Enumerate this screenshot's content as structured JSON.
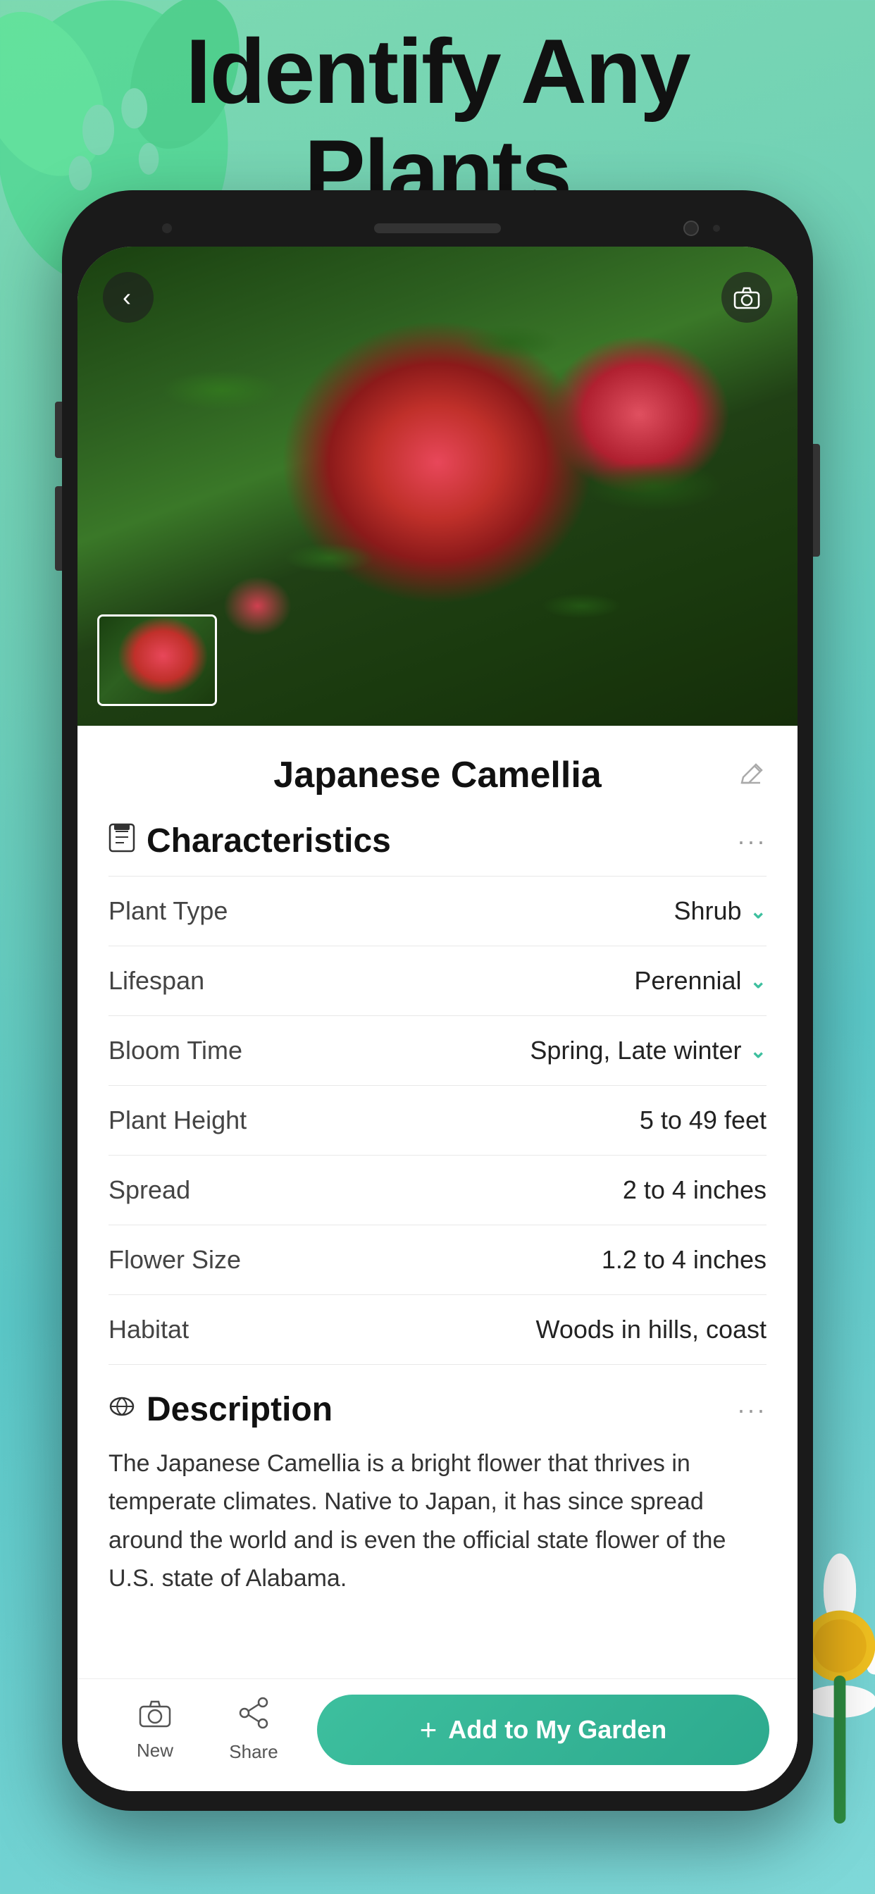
{
  "hero": {
    "title_line1": "Identify Any",
    "title_line2": "Plants"
  },
  "phone": {
    "plant_name": "Japanese Camellia",
    "sections": {
      "characteristics": {
        "title": "Characteristics",
        "icon": "📋",
        "rows": [
          {
            "label": "Plant Type",
            "value": "Shrub",
            "has_chevron": true
          },
          {
            "label": "Lifespan",
            "value": "Perennial",
            "has_chevron": true
          },
          {
            "label": "Bloom Time",
            "value": "Spring, Late winter",
            "has_chevron": true
          },
          {
            "label": "Plant Height",
            "value": "5 to 49 feet",
            "has_chevron": false
          },
          {
            "label": "Spread",
            "value": "2 to 4 inches",
            "has_chevron": false
          },
          {
            "label": "Flower Size",
            "value": "1.2 to 4 inches",
            "has_chevron": false
          },
          {
            "label": "Habitat",
            "value": "Woods in hills, coast",
            "has_chevron": false
          }
        ]
      },
      "description": {
        "title": "Description",
        "icon": "🍃",
        "text": "The Japanese Camellia is a bright flower that thrives in temperate climates. Native to Japan, it has since spread around the world and is even the official state flower of the U.S. state of Alabama."
      }
    },
    "bottom_bar": {
      "new_label": "New",
      "share_label": "Share",
      "add_garden_label": "Add to My Garden"
    }
  }
}
